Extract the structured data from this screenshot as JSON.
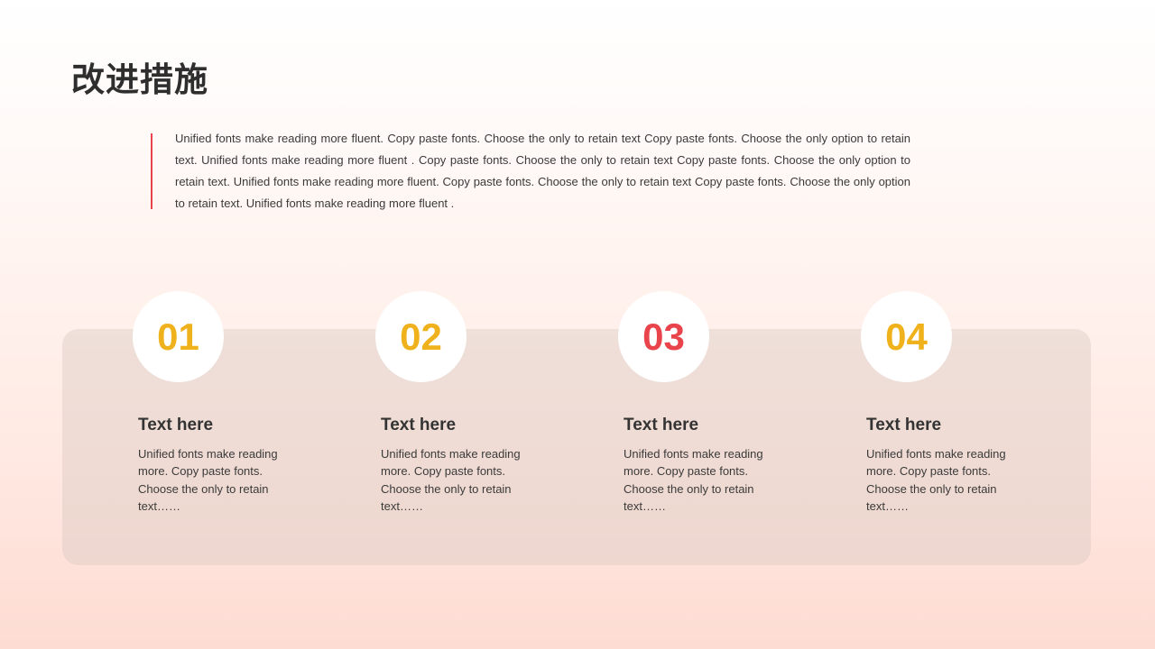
{
  "title": "改进措施",
  "intro": {
    "text": "Unified  fonts make reading more fluent. Copy paste fonts. Choose the only to retain text Copy paste  fonts. Choose the only option to retain text. Unified  fonts make reading more fluent .  Copy paste fonts. Choose the only to retain text Copy paste  fonts. Choose the only option to retain text. Unified  fonts make reading more fluent. Copy paste fonts. Choose the only to retain text Copy paste  fonts. Choose the only option to retain text. Unified  fonts make reading more fluent ."
  },
  "colors": {
    "accent_red": "#e9434b",
    "accent_yellow": "#f0b21c"
  },
  "cards": [
    {
      "number": "01",
      "number_color": "#f0b21c",
      "title": "Text here",
      "text": "Unified  fonts make reading more. Copy paste fonts. Choose the only to retain text……"
    },
    {
      "number": "02",
      "number_color": "#f0b21c",
      "title": "Text here",
      "text": "Unified  fonts make reading more. Copy paste fonts. Choose the only to retain text……"
    },
    {
      "number": "03",
      "number_color": "#e9434b",
      "title": "Text here",
      "text": "Unified  fonts make reading more. Copy paste fonts. Choose the only to retain text……"
    },
    {
      "number": "04",
      "number_color": "#f0b21c",
      "title": "Text here",
      "text": "Unified  fonts make reading more. Copy paste fonts. Choose the only to retain text……"
    }
  ]
}
